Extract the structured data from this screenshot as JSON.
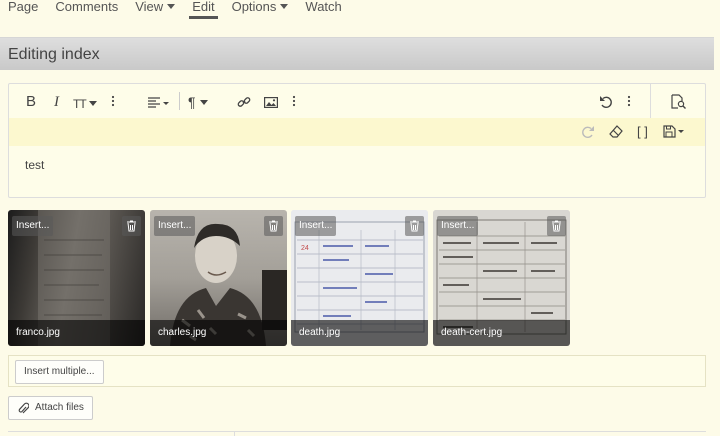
{
  "nav": {
    "items": [
      {
        "label": "Page"
      },
      {
        "label": "Comments"
      },
      {
        "label": "View"
      },
      {
        "label": "Edit"
      },
      {
        "label": "Options"
      },
      {
        "label": "Watch"
      }
    ]
  },
  "heading": {
    "title": "Editing index"
  },
  "editor": {
    "content": "test",
    "icons": {
      "bold": "B",
      "italic": "I",
      "font_size": "TT",
      "paragraph": "¶",
      "code": "[ ]"
    }
  },
  "attachments": [
    {
      "insert_label": "Insert...",
      "filename": "franco.jpg"
    },
    {
      "insert_label": "Insert...",
      "filename": "charles.jpg"
    },
    {
      "insert_label": "Insert...",
      "filename": "death.jpg"
    },
    {
      "insert_label": "Insert...",
      "filename": "death-cert.jpg"
    }
  ],
  "actions": {
    "insert_multiple": "Insert multiple...",
    "attach_files": "Attach files"
  },
  "colors": {
    "page_bg": "#fdfbe8",
    "toolbar_row2": "#fcf8cf"
  }
}
